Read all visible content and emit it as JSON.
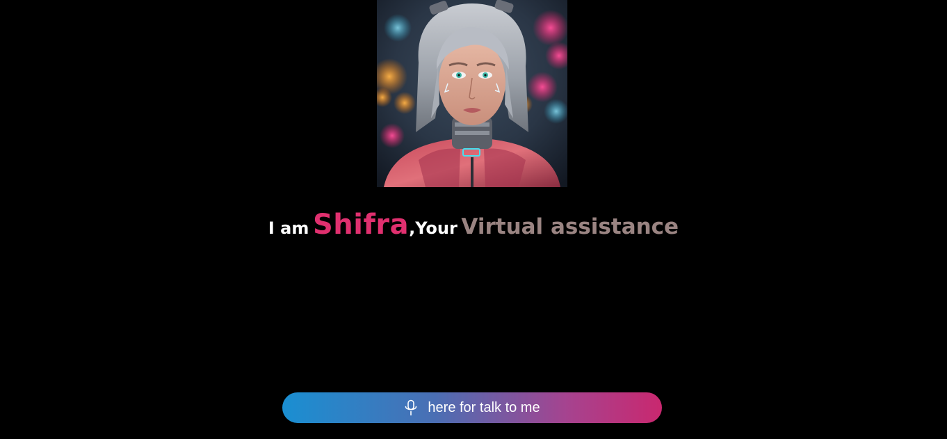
{
  "avatar": {
    "alt": "Shifra cyberpunk avatar portrait",
    "icon": "avatar"
  },
  "headline": {
    "intro": "I am",
    "name": "Shifra",
    "sep": ",",
    "your": "Your",
    "role": "Virtual assistance"
  },
  "talk_button": {
    "icon": "microphone-icon",
    "label": "here for talk to me"
  },
  "colors": {
    "background": "#000000",
    "name_accent": "#e0306f",
    "role_text": "#9a8482",
    "button_gradient_start": "#1a8fd2",
    "button_gradient_end": "#c9286f"
  }
}
